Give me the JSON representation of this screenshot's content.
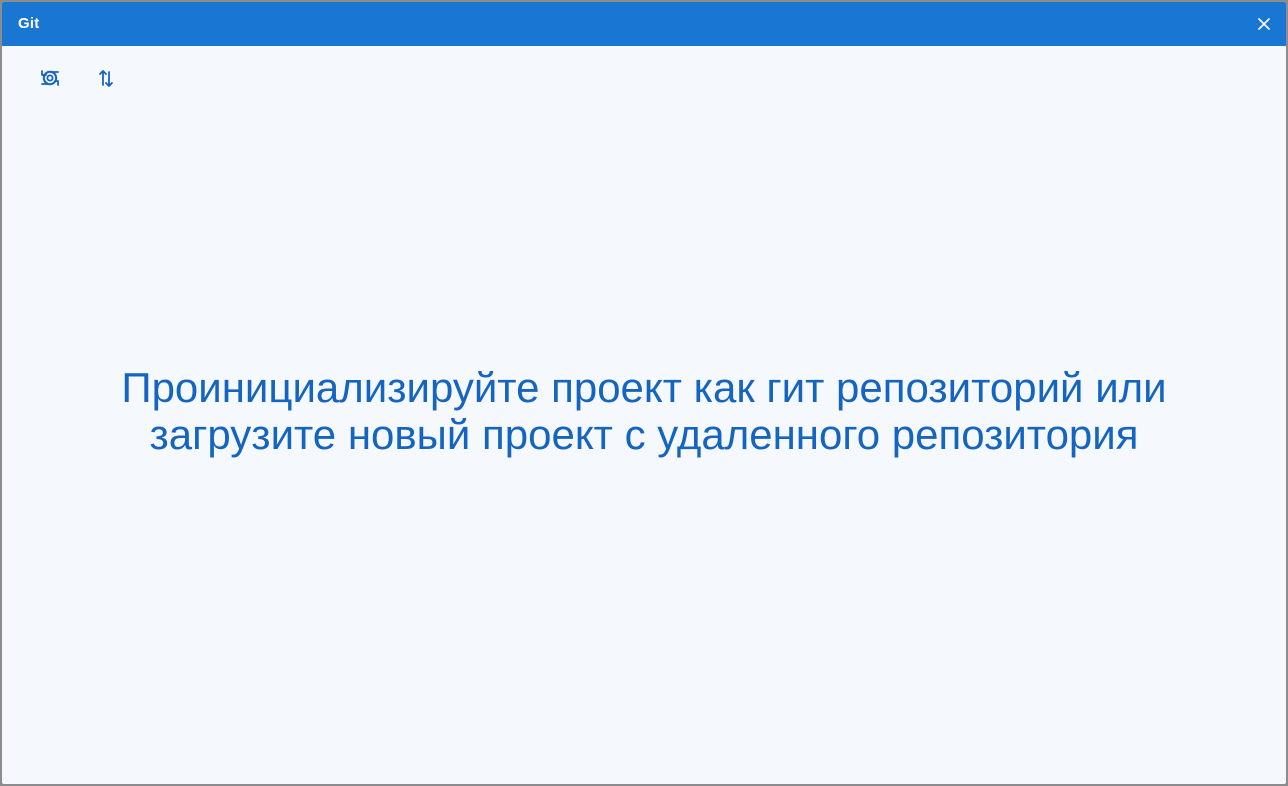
{
  "window": {
    "title": "Git",
    "close_icon": "close-icon"
  },
  "toolbar": {
    "buttons": [
      {
        "icon": "git-init-icon"
      },
      {
        "icon": "sync-arrows-icon"
      }
    ]
  },
  "main": {
    "message_line1": "Проинициализируйте проект как гит репозиторий или",
    "message_line2": "загрузите новый проект с удаленного репозитория"
  },
  "colors": {
    "titlebar": "#1976d2",
    "background": "#f5f9fe",
    "accent_text": "#1565c0"
  }
}
